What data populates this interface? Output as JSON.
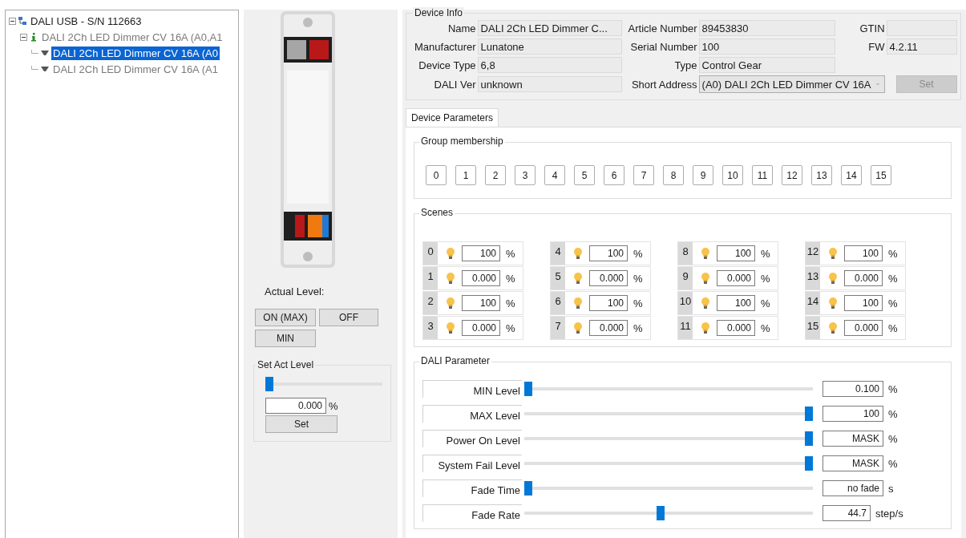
{
  "tree": [
    {
      "label": "DALI USB - S/N 112663",
      "kind": "bus",
      "expanded": true,
      "selected": false,
      "greyed": false,
      "children": [
        {
          "label": "DALI 2Ch LED Dimmer CV 16A (A0,A1",
          "kind": "device",
          "expanded": true,
          "selected": false,
          "greyed": true,
          "children": [
            {
              "label": "DALI 2Ch LED Dimmer CV 16A (A0",
              "kind": "lamp",
              "selected": true,
              "greyed": false
            },
            {
              "label": "DALI 2Ch LED Dimmer CV 16A (A1",
              "kind": "lamp",
              "selected": false,
              "greyed": true
            }
          ]
        }
      ]
    }
  ],
  "actual_level": {
    "label": "Actual Level:",
    "buttons": [
      "ON (MAX)",
      "OFF",
      "MIN"
    ]
  },
  "set_act_level": {
    "title": "Set Act Level",
    "level": 0,
    "value": "0.000",
    "unit": "%",
    "button": "Set"
  },
  "device_info": {
    "title": "Device Info",
    "rows": [
      [
        {
          "kind": "field",
          "label": "Name",
          "value": "DALI 2Ch LED Dimmer C..."
        },
        {
          "kind": "field",
          "label": "Article Number",
          "value": "89453830"
        },
        {
          "kind": "field",
          "label": "GTIN"
        }
      ],
      [
        {
          "kind": "field",
          "label": "Manufacturer",
          "value": "Lunatone"
        },
        {
          "kind": "field",
          "label": "Serial Number",
          "value": "100"
        },
        {
          "kind": "field",
          "label": "FW",
          "value": "4.2.11"
        }
      ],
      [
        {
          "kind": "field",
          "label": "Device Type",
          "value": "6,8"
        },
        {
          "kind": "field",
          "label": "Type",
          "value": "Control Gear"
        }
      ],
      [
        {
          "kind": "field",
          "label": "DALI Ver",
          "value": "unknown"
        },
        {
          "kind": "dropdown",
          "label": "Short Address",
          "value": "(A0) DALI 2Ch LED Dimmer CV 16A"
        },
        {
          "kind": "button",
          "label": "Set",
          "disabled": true
        }
      ]
    ]
  },
  "tabs": [
    {
      "label": "Device Parameters",
      "selected": true
    }
  ],
  "group_membership": {
    "title": "Group membership",
    "groups": [
      "0",
      "1",
      "2",
      "3",
      "4",
      "5",
      "6",
      "7",
      "8",
      "9",
      "10",
      "11",
      "12",
      "13",
      "14",
      "15"
    ]
  },
  "scenes": {
    "title": "Scenes",
    "items": [
      {
        "number": "0",
        "value": "100",
        "unit": "%"
      },
      {
        "number": "1",
        "value": "0.000",
        "unit": "%"
      },
      {
        "number": "2",
        "value": "100",
        "unit": "%"
      },
      {
        "number": "3",
        "value": "0.000",
        "unit": "%"
      },
      {
        "number": "4",
        "value": "100",
        "unit": "%"
      },
      {
        "number": "5",
        "value": "0.000",
        "unit": "%"
      },
      {
        "number": "6",
        "value": "100",
        "unit": "%"
      },
      {
        "number": "7",
        "value": "0.000",
        "unit": "%"
      },
      {
        "number": "8",
        "value": "100",
        "unit": "%"
      },
      {
        "number": "9",
        "value": "0.000",
        "unit": "%"
      },
      {
        "number": "10",
        "value": "100",
        "unit": "%"
      },
      {
        "number": "11",
        "value": "0.000",
        "unit": "%"
      },
      {
        "number": "12",
        "value": "100",
        "unit": "%"
      },
      {
        "number": "13",
        "value": "0.000",
        "unit": "%"
      },
      {
        "number": "14",
        "value": "100",
        "unit": "%"
      },
      {
        "number": "15",
        "value": "0.000",
        "unit": "%"
      }
    ]
  },
  "dali_parameter": {
    "title": "DALI Parameter",
    "rows": [
      {
        "label": "MIN Level",
        "level": 0,
        "value": "0.100",
        "unit": "%"
      },
      {
        "label": "MAX Level",
        "level": 1,
        "value": "100",
        "unit": "%"
      },
      {
        "label": "Power On Level",
        "level": 1,
        "value": "MASK",
        "unit": "%"
      },
      {
        "label": "System Fail Level",
        "level": 1,
        "value": "MASK",
        "unit": "%"
      },
      {
        "label": "Fade Time",
        "level": 0,
        "value": "no fade",
        "unit": "s"
      },
      {
        "label": "Fade Rate",
        "level": 0.47,
        "value": "44.7",
        "unit": "step/s"
      }
    ]
  }
}
